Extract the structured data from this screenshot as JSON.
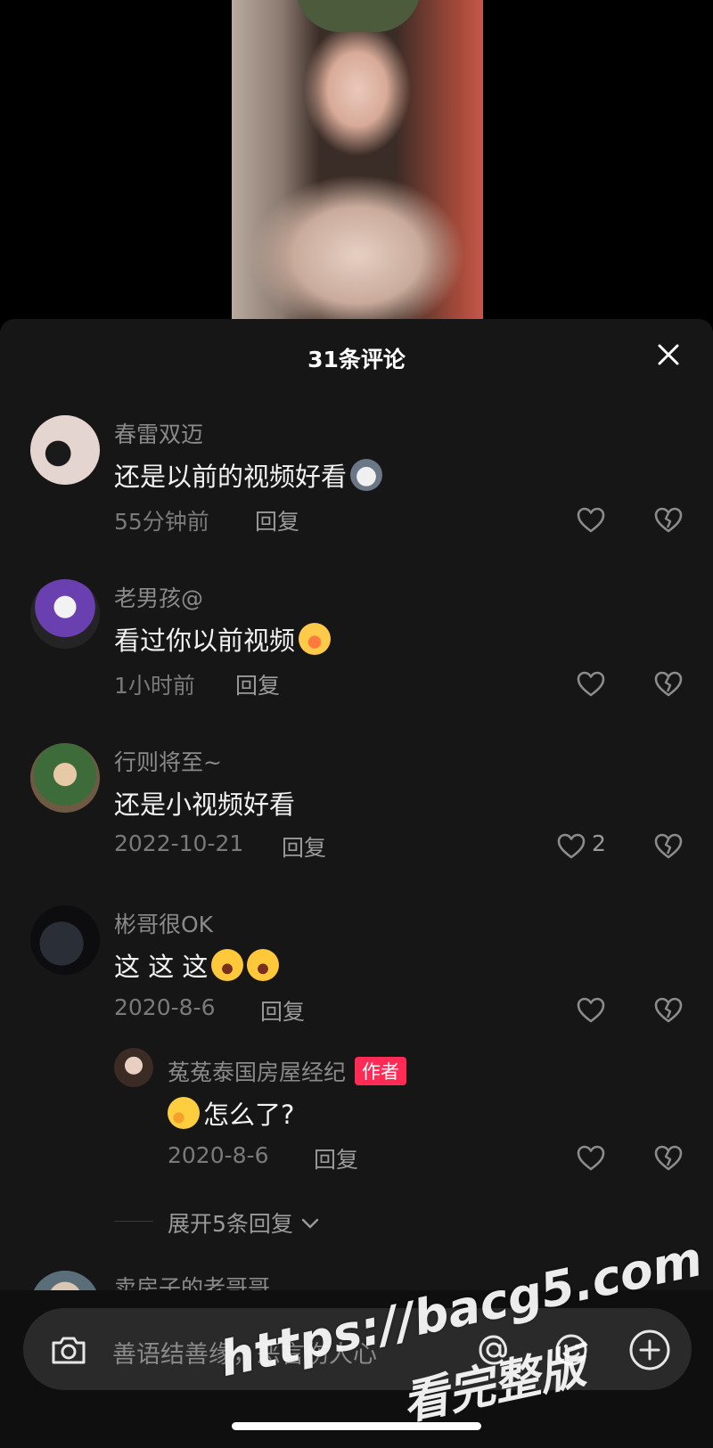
{
  "sheet": {
    "title": "31条评论"
  },
  "comments": [
    {
      "username": "春雷双迈",
      "text": "还是以前的视频好看",
      "emoji": "cat-emoji",
      "time": "55分钟前",
      "reply_label": "回复",
      "likes": ""
    },
    {
      "username": "老男孩@",
      "text": "看过你以前视频",
      "emoji": "shy-emoji",
      "time": "1小时前",
      "reply_label": "回复",
      "likes": ""
    },
    {
      "username": "行则将至~",
      "text": "还是小视频好看",
      "emoji": "",
      "time": "2022-10-21",
      "reply_label": "回复",
      "likes": "2"
    },
    {
      "username": "彬哥很OK",
      "text": "这 这 这",
      "emoji": "laughing-emoji",
      "time": "2020-8-6",
      "reply_label": "回复",
      "likes": ""
    }
  ],
  "author_reply": {
    "username": "菟菟泰国房屋经纪",
    "badge": "作者",
    "text": "怎么了?",
    "emoji": "hand-over-mouth-emoji",
    "time": "2020-8-6",
    "reply_label": "回复"
  },
  "expand_replies": "展开5条回复",
  "next_comment": {
    "username": "卖房子的老哥哥"
  },
  "input": {
    "placeholder": "善语结善缘，恶言伤人心"
  },
  "watermark": {
    "line1": "https://bacg5.com",
    "line2": "看完整版"
  },
  "colors": {
    "badge": "#fe2c55",
    "sheet_bg": "#161616",
    "accent": "#ffffff"
  }
}
